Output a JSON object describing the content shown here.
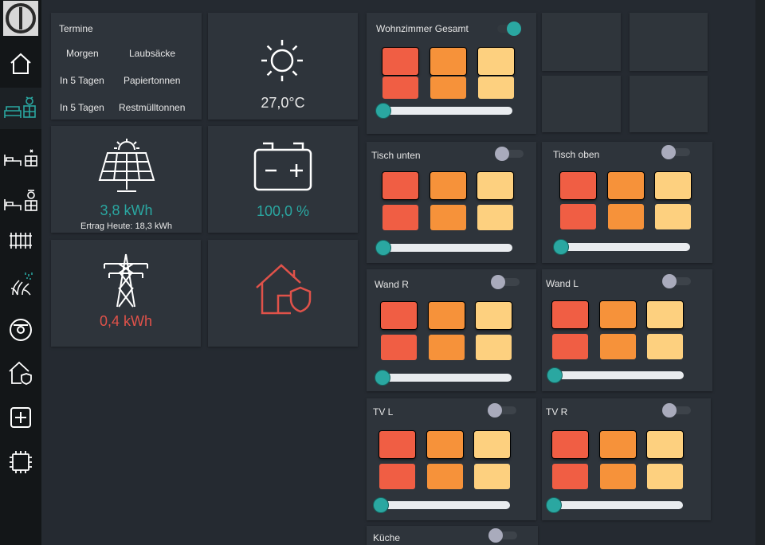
{
  "sidebar": {
    "items": [
      {
        "icon": "power-logo-icon"
      },
      {
        "icon": "home-icon"
      },
      {
        "icon": "living-room-icon",
        "active": true
      },
      {
        "icon": "bedroom-icon"
      },
      {
        "icon": "kids-bedroom-icon"
      },
      {
        "icon": "radiator-icon"
      },
      {
        "icon": "garden-irrigation-icon"
      },
      {
        "icon": "robot-vacuum-icon"
      },
      {
        "icon": "home-security-icon"
      },
      {
        "icon": "add-icon"
      },
      {
        "icon": "chip-icon"
      }
    ]
  },
  "termine": {
    "title": "Termine",
    "rows": [
      {
        "when": "Morgen",
        "what": "Laubsäcke"
      },
      {
        "when": "In 5 Tagen",
        "what": "Papiertonnen"
      },
      {
        "when": "In 5 Tagen",
        "what": "Restmülltonnen"
      }
    ]
  },
  "weather": {
    "temperature": "27,0°C",
    "icon": "sun-icon"
  },
  "solar": {
    "value": "3,8 kWh",
    "note": "Ertrag Heute: 18,3 kWh",
    "icon": "solar-panel-icon"
  },
  "battery": {
    "value": "100,0 %",
    "icon": "battery-icon"
  },
  "grid": {
    "value": "0,4 kWh",
    "icon": "power-pylon-icon"
  },
  "security": {
    "icon": "home-shield-icon"
  },
  "colors": {
    "teal": "#2aa7a1",
    "red": "#e0524a",
    "swatch_red": "#f05e44",
    "swatch_orange": "#f6923a",
    "swatch_yellow": "#fdd07f"
  },
  "lights": [
    {
      "name": "Wohnzimmer Gesamt",
      "on": true,
      "brightness": 0
    },
    {
      "name": "Tisch unten",
      "on": false,
      "brightness": 0
    },
    {
      "name": "Tisch oben",
      "on": false,
      "brightness": 0
    },
    {
      "name": "Wand R",
      "on": false,
      "brightness": 0
    },
    {
      "name": "Wand L",
      "on": false,
      "brightness": 0
    },
    {
      "name": "TV L",
      "on": false,
      "brightness": 0
    },
    {
      "name": "TV R",
      "on": false,
      "brightness": 0
    },
    {
      "name": "Küche",
      "on": false
    }
  ]
}
